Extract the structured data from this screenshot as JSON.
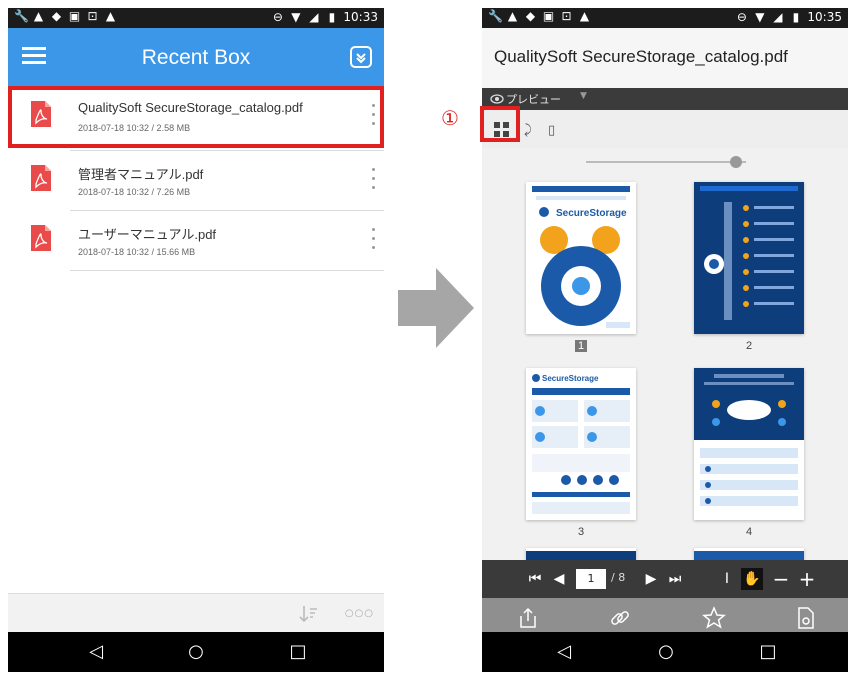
{
  "left_screen": {
    "status_time": "10:33",
    "header_title": "Recent Box",
    "files": [
      {
        "name": "QualitySoft SecureStorage_catalog.pdf",
        "meta": "2018-07-18 10:32 / 2.58 MB"
      },
      {
        "name": "管理者マニュアル.pdf",
        "meta": "2018-07-18 10:32 / 7.26 MB"
      },
      {
        "name": "ユーザーマニュアル.pdf",
        "meta": "2018-07-18 10:32 / 15.66 MB"
      }
    ],
    "more_label": "○○○"
  },
  "annotation": {
    "step_marker": "①"
  },
  "right_screen": {
    "status_time": "10:35",
    "document_title": "QualitySoft SecureStorage_catalog.pdf",
    "preview_label": "プレビュー",
    "zoom_level": 0.97,
    "thumbnails": [
      {
        "page_label": "1",
        "brand": "SecureStorage"
      },
      {
        "page_label": "2"
      },
      {
        "page_label": "3",
        "brand": "SecureStorage"
      },
      {
        "page_label": "4"
      }
    ],
    "pager": {
      "current_page": "1",
      "total_pages": "/ 8"
    }
  },
  "colors": {
    "accent_blue": "#3c97e8",
    "highlight_red": "#e1201f",
    "pdf_red": "#e94b4b"
  }
}
